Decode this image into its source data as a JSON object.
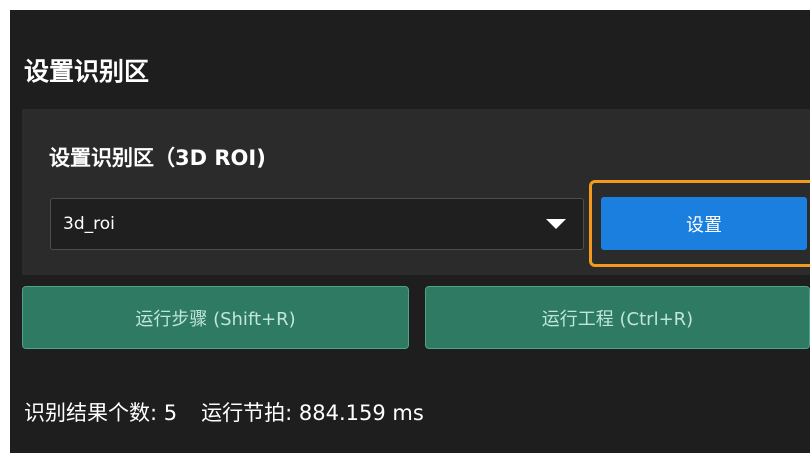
{
  "section": {
    "title": "设置识别区"
  },
  "roi_group": {
    "label": "设置识别区（3D ROI)",
    "selected_roi": "3d_roi",
    "set_button_label": "设置"
  },
  "actions": {
    "run_step_label": "运行步骤 (Shift+R)",
    "run_project_label": "运行工程 (Ctrl+R)"
  },
  "status": {
    "result_count": "识别结果个数: 5",
    "cycle_time": "运行节拍: 884.159 ms"
  },
  "colors": {
    "primary_button": "#1b7fe0",
    "run_button": "#2e7a63",
    "highlight": "#f39a1e"
  },
  "icons": {
    "dropdown": "chevron-down-icon"
  }
}
